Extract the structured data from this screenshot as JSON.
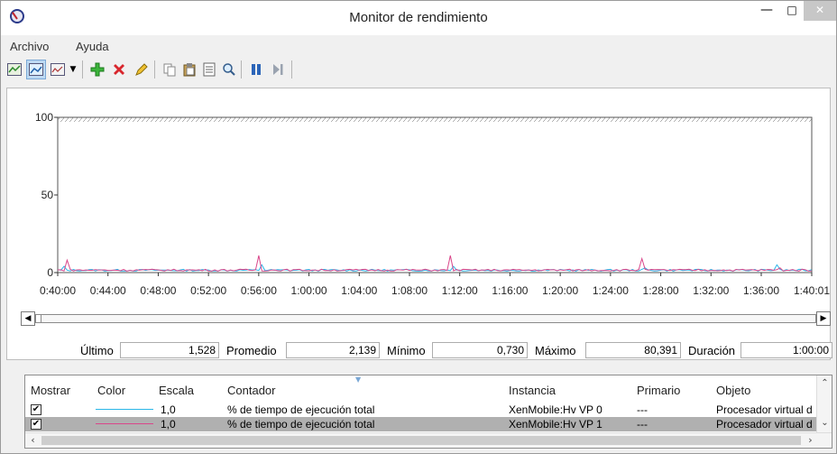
{
  "window": {
    "title": "Monitor de rendimiento"
  },
  "menu": {
    "items": [
      "Archivo",
      "Ayuda"
    ]
  },
  "toolbar": {
    "buttons": [
      {
        "name": "view-current-activity",
        "icon": "chart-icon"
      },
      {
        "name": "view-log-data",
        "icon": "log-data-icon"
      },
      {
        "name": "change-graph-type",
        "icon": "graph-type-icon"
      },
      {
        "name": "add-counter",
        "icon": "plus-icon"
      },
      {
        "name": "delete-counter",
        "icon": "delete-icon"
      },
      {
        "name": "highlight",
        "icon": "highlighter-icon"
      },
      {
        "name": "copy-properties",
        "icon": "copy-icon"
      },
      {
        "name": "paste-counter-list",
        "icon": "paste-icon"
      },
      {
        "name": "properties",
        "icon": "properties-icon"
      },
      {
        "name": "zoom",
        "icon": "zoom-icon"
      },
      {
        "name": "freeze-display",
        "icon": "pause-icon"
      },
      {
        "name": "update-data",
        "icon": "step-icon"
      }
    ]
  },
  "chart_data": {
    "type": "line",
    "title": "",
    "ylim": [
      0,
      100
    ],
    "yticks": [
      "100",
      "50",
      "0"
    ],
    "xticks": [
      "0:40:00",
      "0:44:00",
      "0:48:00",
      "0:52:00",
      "0:56:00",
      "1:00:00",
      "1:04:00",
      "1:08:00",
      "1:12:00",
      "1:16:00",
      "1:20:00",
      "1:24:00",
      "1:28:00",
      "1:32:00",
      "1:36:00",
      "1:40:01"
    ],
    "x_minutes_range": [
      40,
      100.02
    ],
    "series": [
      {
        "color": "#2ab6e8",
        "baseline": 1.5,
        "spikes": [
          [
            40.5,
            4
          ],
          [
            56.3,
            5
          ],
          [
            71.5,
            4
          ],
          [
            86.7,
            3
          ],
          [
            97.2,
            5
          ]
        ]
      },
      {
        "color": "#d9468a",
        "baseline": 1.6,
        "spikes": [
          [
            40.7,
            8
          ],
          [
            56.1,
            11
          ],
          [
            71.3,
            11
          ],
          [
            86.5,
            9
          ],
          [
            97.4,
            3
          ]
        ]
      }
    ],
    "grid": false
  },
  "stats": {
    "ultimo_label": "Último",
    "ultimo_value": "1,528",
    "promedio_label": "Promedio",
    "promedio_value": "2,139",
    "minimo_label": "Mínimo",
    "minimo_value": "0,730",
    "maximo_label": "Máximo",
    "maximo_value": "80,391",
    "duracion_label": "Duración",
    "duracion_value": "1:00:00"
  },
  "counters": {
    "headers": [
      "Mostrar",
      "Color",
      "Escala",
      "Contador",
      "Instancia",
      "Primario",
      "Objeto"
    ],
    "rows": [
      {
        "show": "✔",
        "color": "#2ab6e8",
        "scale": "1,0",
        "counter": "% de tiempo de ejecución total",
        "instance": "XenMobile:Hv VP 0",
        "parent": "---",
        "object": "Procesador virtual d"
      },
      {
        "show": "✔",
        "color": "#d9468a",
        "scale": "1,0",
        "counter": "% de tiempo de ejecución total",
        "instance": "XenMobile:Hv VP 1",
        "parent": "---",
        "object": "Procesador virtual d"
      }
    ]
  }
}
